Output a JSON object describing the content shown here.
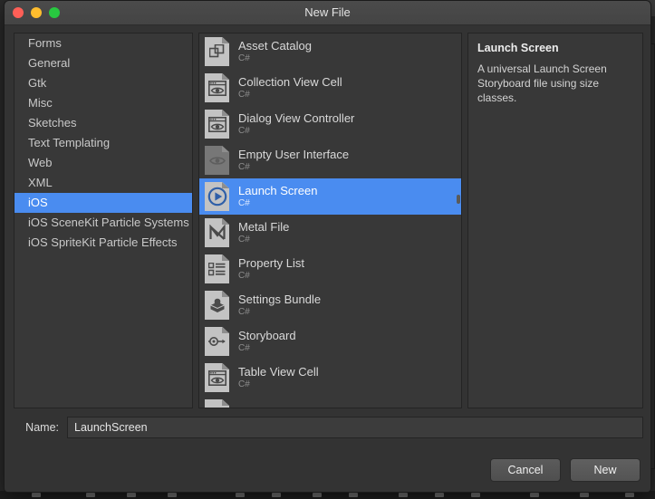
{
  "window": {
    "title": "New File",
    "traffic_lights": [
      {
        "name": "close",
        "color": "#ff5f57"
      },
      {
        "name": "minimize",
        "color": "#ffbd2e"
      },
      {
        "name": "zoom",
        "color": "#28c840"
      }
    ]
  },
  "categories": {
    "items": [
      {
        "label": "Forms",
        "selected": false
      },
      {
        "label": "General",
        "selected": false
      },
      {
        "label": "Gtk",
        "selected": false
      },
      {
        "label": "Misc",
        "selected": false
      },
      {
        "label": "Sketches",
        "selected": false
      },
      {
        "label": "Text Templating",
        "selected": false
      },
      {
        "label": "Web",
        "selected": false
      },
      {
        "label": "XML",
        "selected": false
      },
      {
        "label": "iOS",
        "selected": true
      },
      {
        "label": "iOS SceneKit Particle Systems",
        "selected": false
      },
      {
        "label": "iOS SpriteKit Particle Effects",
        "selected": false
      }
    ]
  },
  "templates": {
    "items": [
      {
        "title": "Asset Catalog",
        "subtitle": "C#",
        "icon": "asset-catalog-icon",
        "selected": false
      },
      {
        "title": "Collection View Cell",
        "subtitle": "C#",
        "icon": "collection-view-cell-icon",
        "selected": false
      },
      {
        "title": "Dialog View Controller",
        "subtitle": "C#",
        "icon": "dialog-view-controller-icon",
        "selected": false
      },
      {
        "title": "Empty User Interface",
        "subtitle": "C#",
        "icon": "empty-user-interface-icon",
        "selected": false
      },
      {
        "title": "Launch Screen",
        "subtitle": "C#",
        "icon": "launch-screen-icon",
        "selected": true
      },
      {
        "title": "Metal File",
        "subtitle": "C#",
        "icon": "metal-file-icon",
        "selected": false
      },
      {
        "title": "Property List",
        "subtitle": "C#",
        "icon": "property-list-icon",
        "selected": false
      },
      {
        "title": "Settings Bundle",
        "subtitle": "C#",
        "icon": "settings-bundle-icon",
        "selected": false
      },
      {
        "title": "Storyboard",
        "subtitle": "C#",
        "icon": "storyboard-icon",
        "selected": false
      },
      {
        "title": "Table View Cell",
        "subtitle": "C#",
        "icon": "table-view-cell-icon",
        "selected": false
      }
    ]
  },
  "details": {
    "title": "Launch Screen",
    "description": "A universal Launch Screen Storyboard file using size classes."
  },
  "name_row": {
    "label": "Name:",
    "value": "LaunchScreen",
    "placeholder": ""
  },
  "buttons": {
    "cancel": "Cancel",
    "new": "New"
  },
  "colors": {
    "selection_blue": "#4a8cf0",
    "window_bg": "#333333",
    "pane_bg": "#383838",
    "titlebar": "#474747"
  }
}
